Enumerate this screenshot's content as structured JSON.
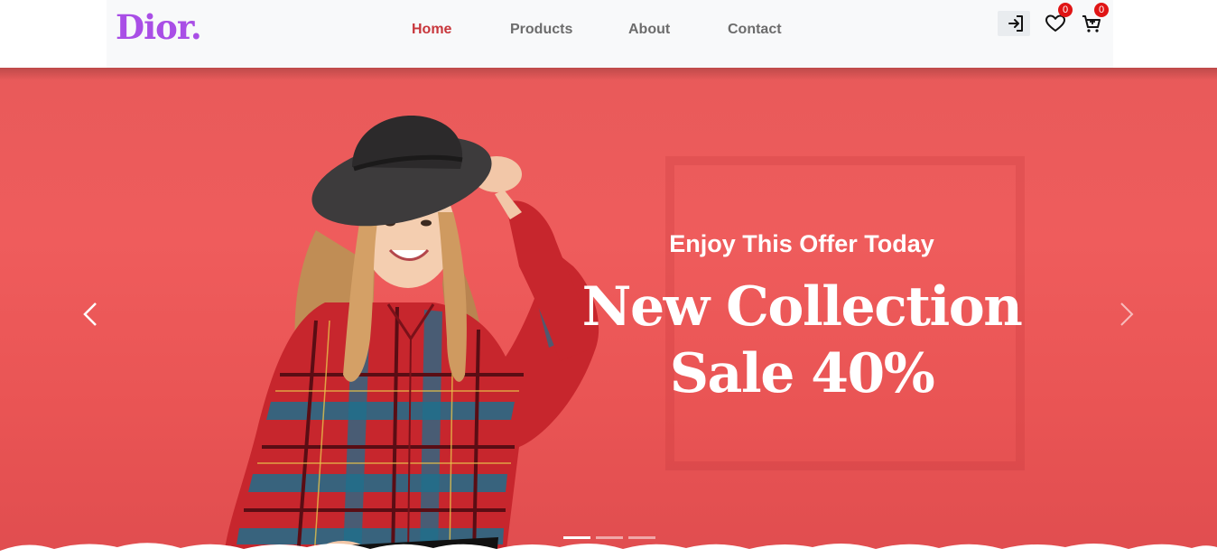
{
  "brand": {
    "logo_text": "Dior."
  },
  "nav": {
    "links": [
      {
        "label": "Home",
        "active": true
      },
      {
        "label": "Products",
        "active": false
      },
      {
        "label": "About",
        "active": false
      },
      {
        "label": "Contact",
        "active": false
      }
    ]
  },
  "header_icons": {
    "login": {
      "icon": "login-icon"
    },
    "wishlist": {
      "icon": "heart-icon",
      "count": "0"
    },
    "cart": {
      "icon": "cart-icon",
      "count": "0"
    }
  },
  "hero": {
    "subtitle": "Enjoy This Offer Today",
    "headline_line1": "New Collection",
    "headline_line2": "Sale 40%",
    "prev_icon": "chevron-left-icon",
    "next_icon": "chevron-right-icon",
    "slides_total": 3,
    "active_slide": 1
  },
  "colors": {
    "brand": "#a94ee6",
    "nav_active": "#c8373c",
    "hero_bg": "#ef5c5c",
    "badge": "#e01515"
  }
}
